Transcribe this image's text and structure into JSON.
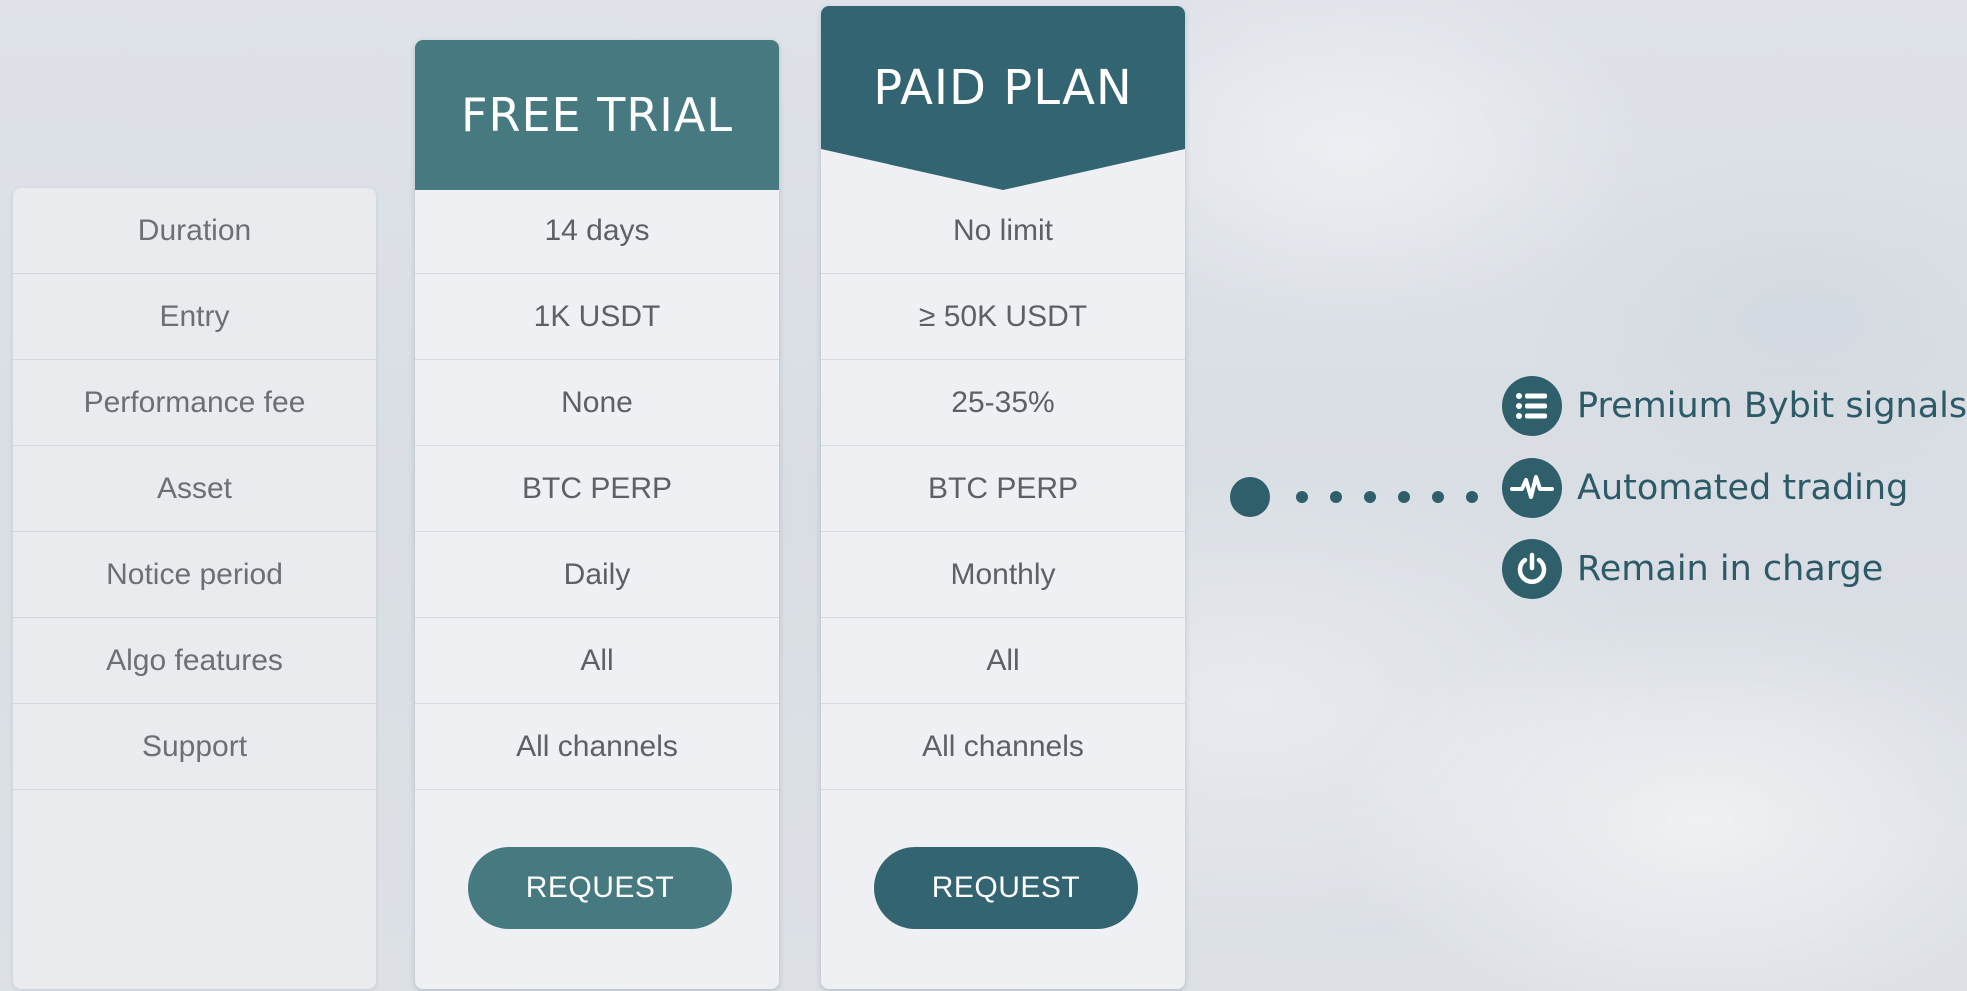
{
  "row_labels": {
    "duration": "Duration",
    "entry": "Entry",
    "performance_fee": "Performance fee",
    "asset": "Asset",
    "notice_period": "Notice period",
    "algo_features": "Algo features",
    "support": "Support"
  },
  "free_plan": {
    "title": "FREE TRIAL",
    "duration": "14 days",
    "entry": "1K USDT",
    "performance_fee": "None",
    "asset": "BTC PERP",
    "notice_period": "Daily",
    "algo_features": "All",
    "support": "All channels",
    "button_label": "REQUEST",
    "color": "#467a80"
  },
  "paid_plan": {
    "title": "PAID PLAN",
    "duration": "No limit",
    "entry": "≥ 50K USDT",
    "performance_fee": "25-35%",
    "asset": "BTC PERP",
    "notice_period": "Monthly",
    "algo_features": "All",
    "support": "All channels",
    "button_label": "REQUEST",
    "color": "#326571"
  },
  "features": [
    {
      "icon": "list-icon",
      "label": "Premium Bybit signals"
    },
    {
      "icon": "pulse-icon",
      "label": "Automated trading"
    },
    {
      "icon": "power-icon",
      "label": "Remain in charge"
    }
  ],
  "accent_color": "#2f5f6b"
}
